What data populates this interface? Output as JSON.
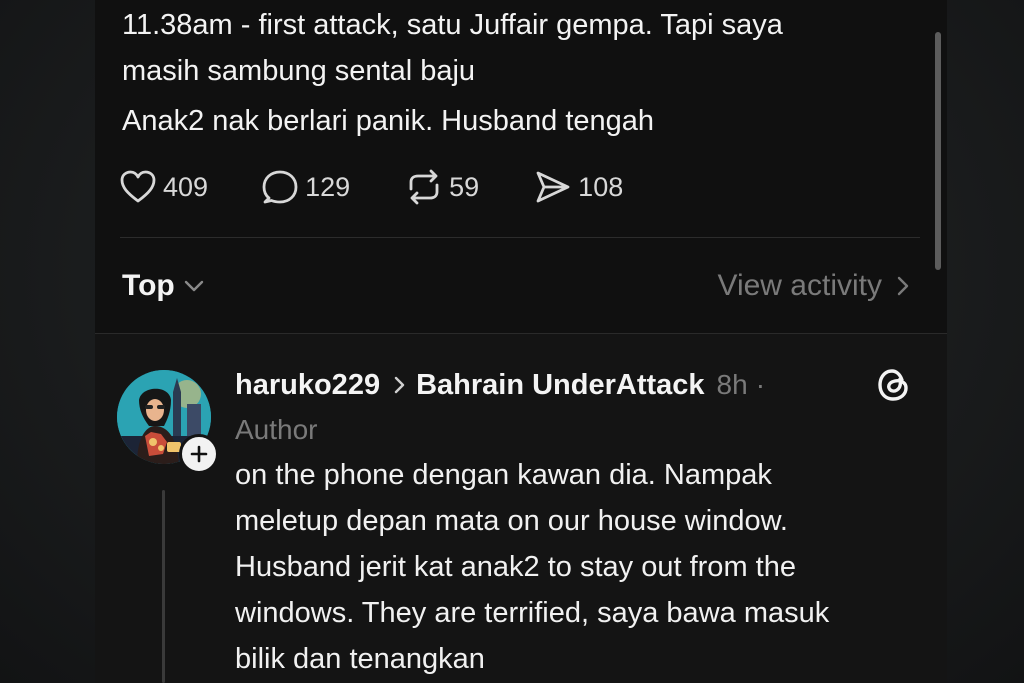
{
  "post": {
    "lines": [
      "11.38am - first attack, satu Juffair gempa. Tapi saya",
      "masih sambung sental baju",
      "Anak2 nak berlari panik. Husband tengah"
    ],
    "stats": {
      "likes": "409",
      "replies": "129",
      "reposts": "59",
      "shares": "108"
    }
  },
  "sort": {
    "label": "Top",
    "view_activity": "View activity"
  },
  "reply": {
    "username": "haruko229",
    "community": "Bahrain UnderAttack",
    "time": "8h",
    "separator": "·",
    "role": "Author",
    "lines": [
      "on the phone dengan kawan dia. Nampak",
      "meletup depan mata on our house window.",
      "Husband jerit kat anak2 to stay out from the",
      "windows. They are terrified, saya bawa masuk",
      "bilik dan tenangkan"
    ]
  },
  "icons": {
    "like": "heart-icon",
    "reply": "comment-icon",
    "repost": "repost-icon",
    "share": "send-icon",
    "sort": "chevron-down-icon",
    "activity": "chevron-right-icon",
    "follow": "plus-icon",
    "community": "chevron-right-icon",
    "app": "threads-icon"
  },
  "colors": {
    "background": "#101010",
    "text": "#f3f3f3",
    "muted": "#7a7a7a"
  }
}
